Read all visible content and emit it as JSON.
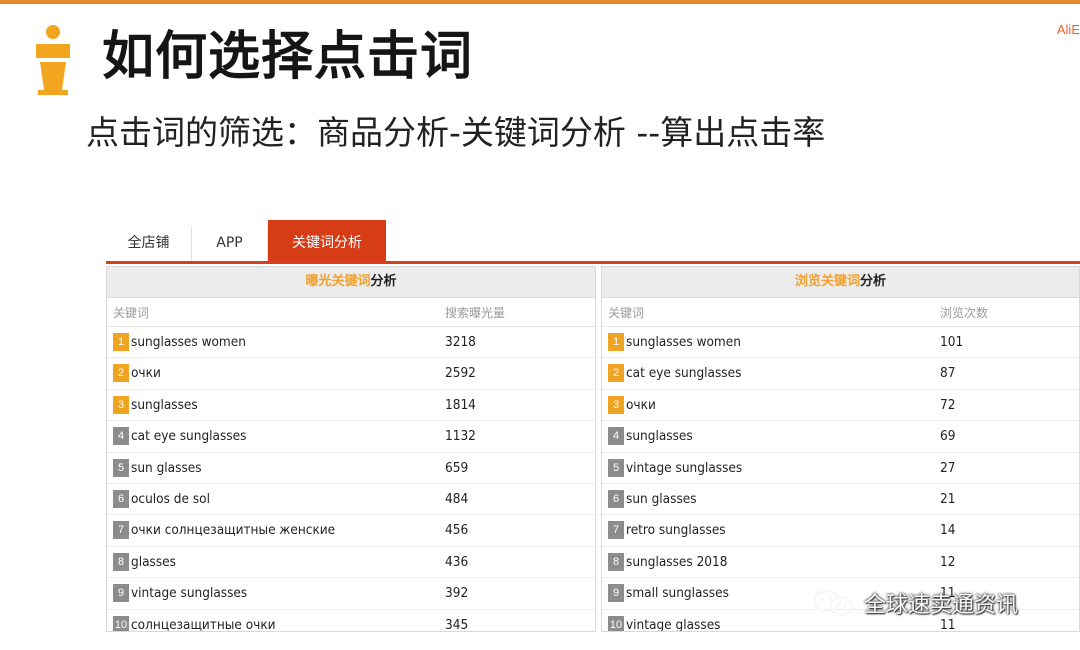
{
  "slide": {
    "brand": "AliE",
    "title": "如何选择点击词",
    "subtitle": "点击词的筛选：商品分析-关键词分析 --算出点击率"
  },
  "tabs": [
    {
      "label": "全店铺",
      "active": false
    },
    {
      "label": "APP",
      "active": false
    },
    {
      "label": "关键词分析",
      "active": true
    }
  ],
  "exposure_panel": {
    "title_accent": "曝光关键词",
    "title_rest": "分析",
    "col_keyword": "关键词",
    "col_value": "搜索曝光量",
    "rows": [
      {
        "rank": "1",
        "keyword": "sunglasses women",
        "value": "3218"
      },
      {
        "rank": "2",
        "keyword": "очки",
        "value": "2592"
      },
      {
        "rank": "3",
        "keyword": "sunglasses",
        "value": "1814"
      },
      {
        "rank": "4",
        "keyword": "cat eye sunglasses",
        "value": "1132"
      },
      {
        "rank": "5",
        "keyword": "sun glasses",
        "value": "659"
      },
      {
        "rank": "6",
        "keyword": "oculos de sol",
        "value": "484"
      },
      {
        "rank": "7",
        "keyword": "очки солнцезащитные женские",
        "value": "456"
      },
      {
        "rank": "8",
        "keyword": "glasses",
        "value": "436"
      },
      {
        "rank": "9",
        "keyword": "vintage sunglasses",
        "value": "392"
      },
      {
        "rank": "10",
        "keyword": "солнцезащитные очки",
        "value": "345"
      }
    ]
  },
  "browse_panel": {
    "title_accent": "浏览关键词",
    "title_rest": "分析",
    "col_keyword": "关键词",
    "col_value": "浏览次数",
    "rows": [
      {
        "rank": "1",
        "keyword": "sunglasses women",
        "value": "101"
      },
      {
        "rank": "2",
        "keyword": "cat eye sunglasses",
        "value": "87"
      },
      {
        "rank": "3",
        "keyword": "очки",
        "value": "72"
      },
      {
        "rank": "4",
        "keyword": "sunglasses",
        "value": "69"
      },
      {
        "rank": "5",
        "keyword": "vintage sunglasses",
        "value": "27"
      },
      {
        "rank": "6",
        "keyword": "sun glasses",
        "value": "21"
      },
      {
        "rank": "7",
        "keyword": "retro sunglasses",
        "value": "14"
      },
      {
        "rank": "8",
        "keyword": "sunglasses 2018",
        "value": "12"
      },
      {
        "rank": "9",
        "keyword": "small sunglasses",
        "value": "11"
      },
      {
        "rank": "10",
        "keyword": "vintage glasses",
        "value": "11"
      }
    ]
  },
  "watermark": {
    "text": "全球速卖通资讯",
    "icon": "wechat-icon"
  },
  "colors": {
    "accent_orange": "#f0a522",
    "tab_red": "#d63c16",
    "rank_gray": "#8c8c8c",
    "top_bar": "#e58a2a"
  }
}
